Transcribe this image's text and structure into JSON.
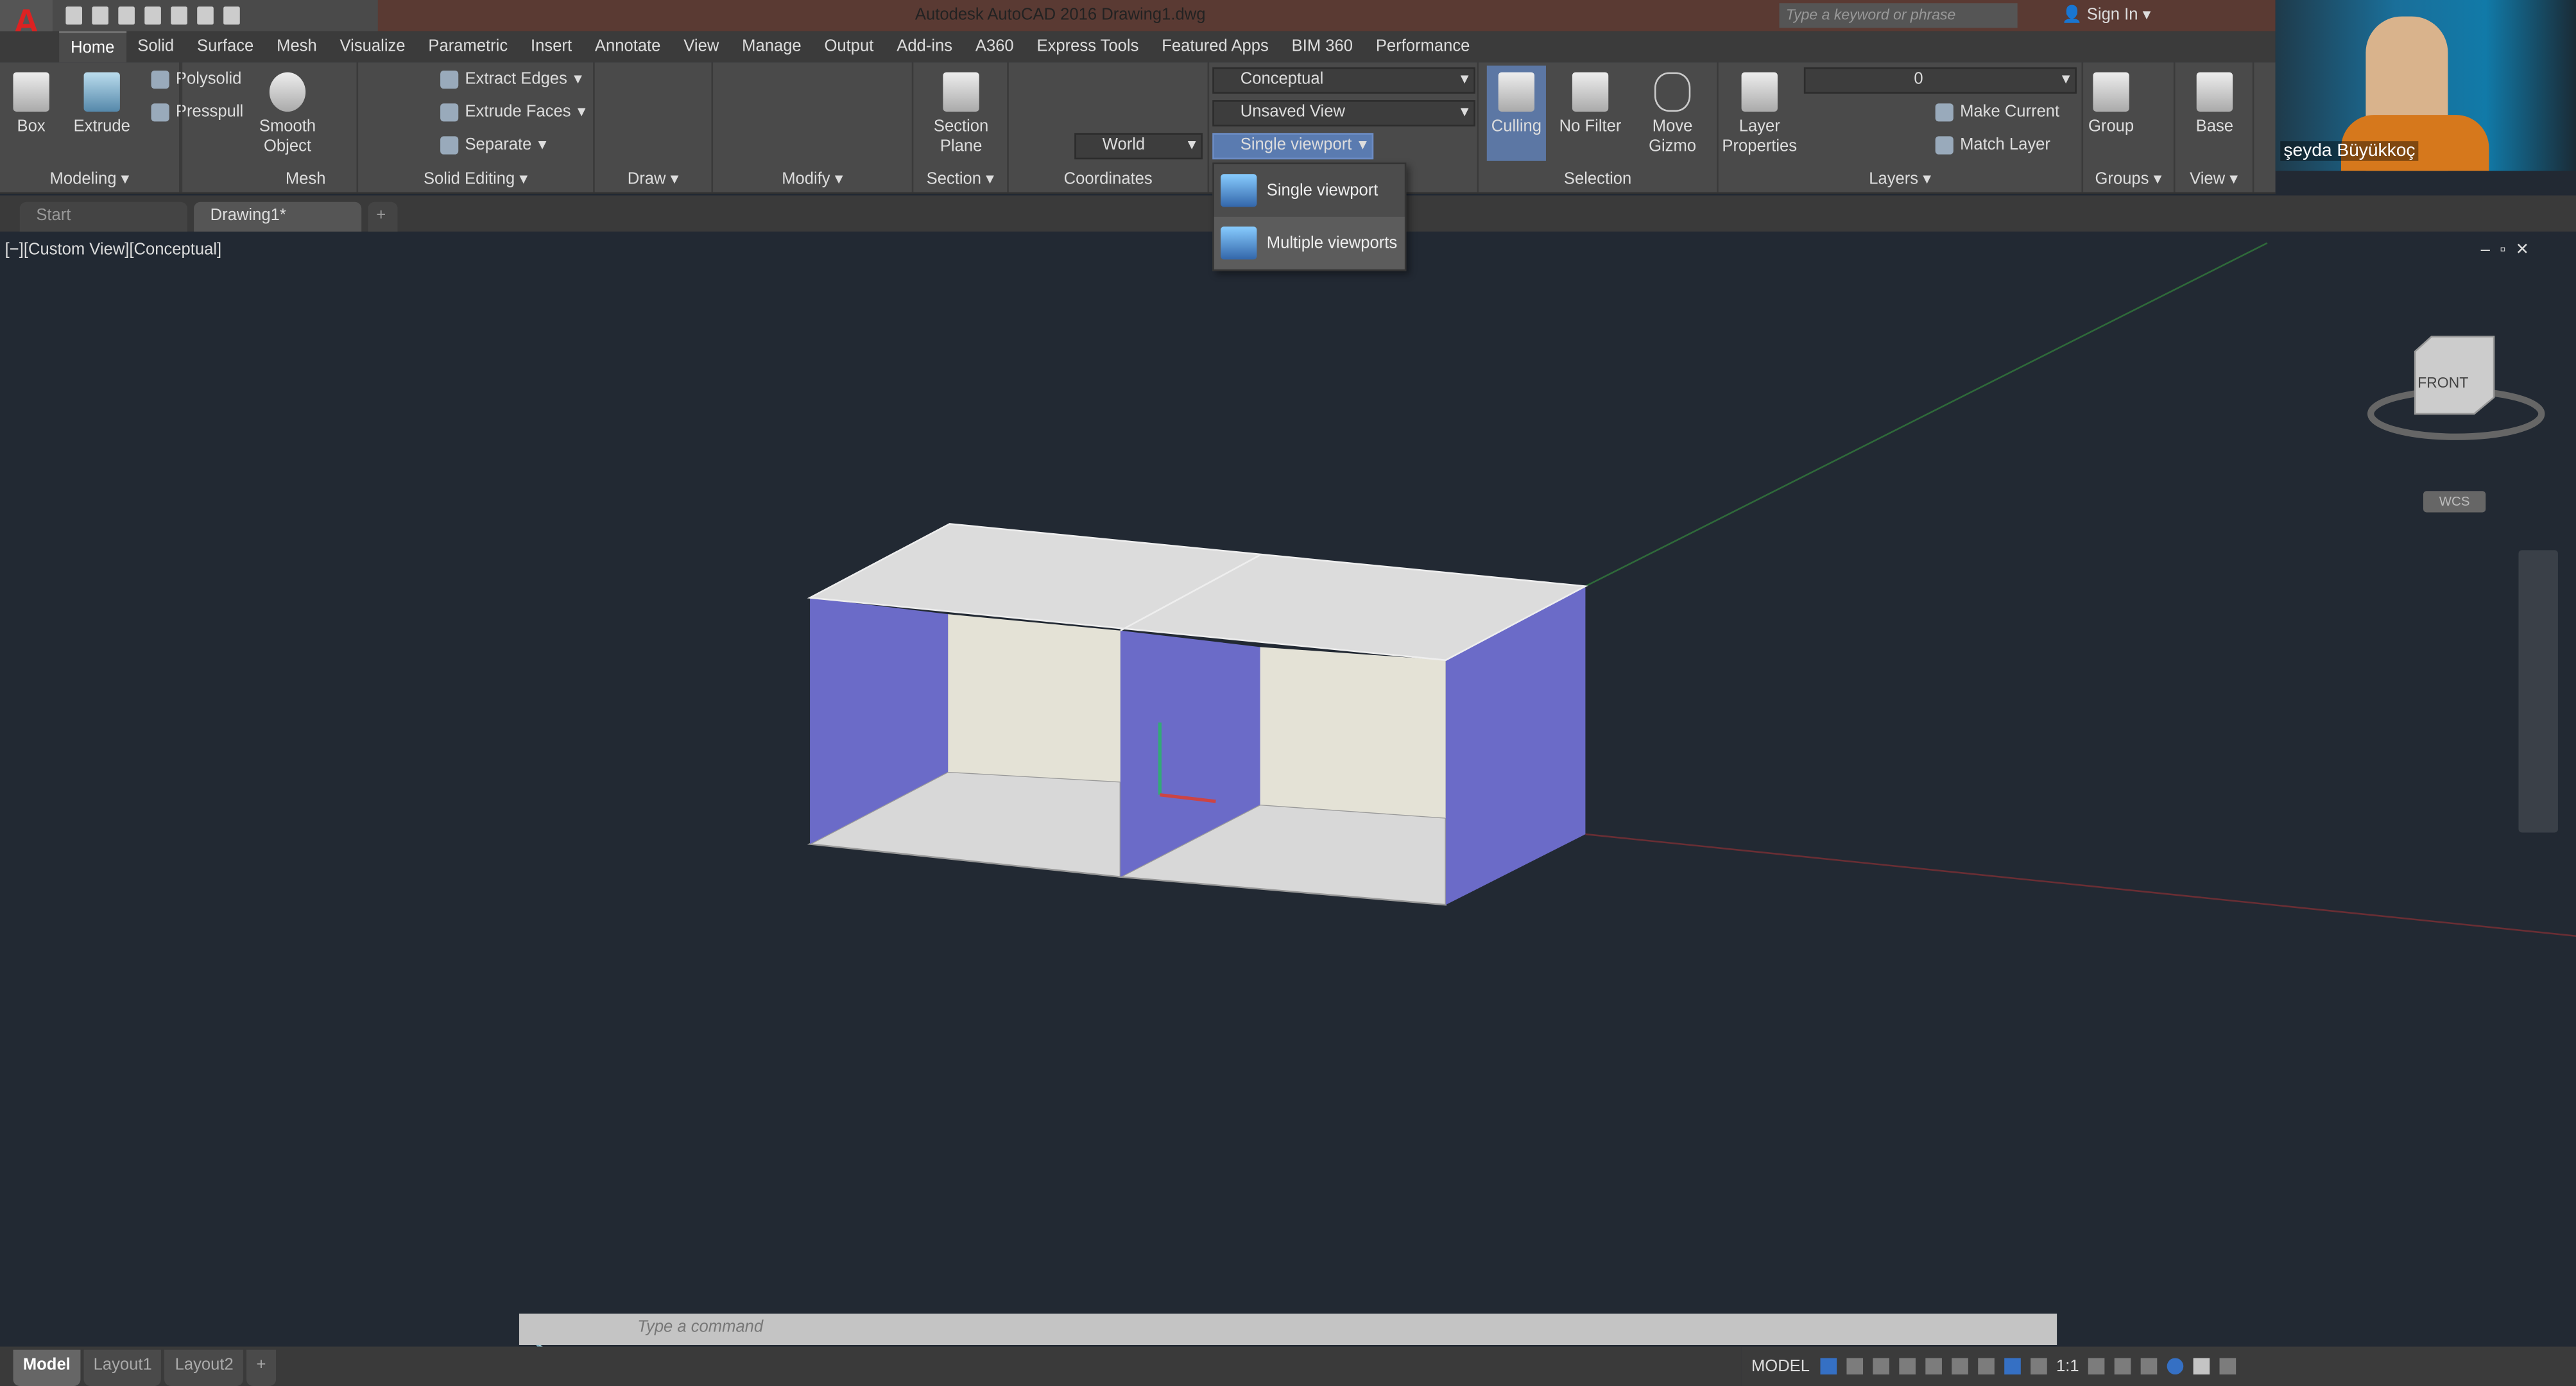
{
  "app": {
    "logo": "A",
    "title": "Autodesk AutoCAD 2016    Drawing1.dwg",
    "search_placeholder": "Type a keyword or phrase",
    "sign_in": "Sign In"
  },
  "ribbon_tabs": [
    "Home",
    "Solid",
    "Surface",
    "Mesh",
    "Visualize",
    "Parametric",
    "Insert",
    "Annotate",
    "View",
    "Manage",
    "Output",
    "Add-ins",
    "A360",
    "Express Tools",
    "Featured Apps",
    "BIM 360",
    "Performance"
  ],
  "panels": {
    "modeling": {
      "label": "Modeling ▾",
      "box": "Box",
      "extrude": "Extrude",
      "polysolid": "Polysolid",
      "presspull": "Presspull"
    },
    "mesh": {
      "label": "Mesh",
      "smooth": "Smooth Object"
    },
    "solid_editing": {
      "label": "Solid Editing ▾",
      "extract_edges": "Extract Edges",
      "extrude_faces": "Extrude Faces",
      "separate": "Separate"
    },
    "draw": {
      "label": "Draw ▾"
    },
    "modify": {
      "label": "Modify ▾"
    },
    "section": {
      "label": "Section ▾",
      "section_plane": "Section Plane"
    },
    "coordinates": {
      "label": "Coordinates",
      "ucs": "World"
    },
    "view": {
      "visual_style": "Conceptual",
      "named_view": "Unsaved View",
      "viewport": "Single viewport"
    },
    "selection": {
      "label": "Selection",
      "culling": "Culling",
      "no_filter": "No Filter",
      "move_gizmo": "Move Gizmo"
    },
    "layers": {
      "label": "Layers ▾",
      "layer_properties": "Layer Properties",
      "current_layer": "0",
      "make_current": "Make Current",
      "match_layer": "Match Layer"
    },
    "groups": {
      "label": "Groups ▾",
      "group": "Group"
    },
    "view_panel": {
      "label": "View ▾",
      "base": "Base"
    }
  },
  "viewport_menu": {
    "items": [
      "Single viewport",
      "Multiple viewports"
    ],
    "hovered": "Multiple viewports"
  },
  "doc_tabs": [
    "Start",
    "Drawing1*"
  ],
  "viewport_label": "[−][Custom View][Conceptual]",
  "viewcube": {
    "face": "FRONT",
    "wcs": "WCS"
  },
  "webcam": {
    "name": "şeyda Büyükkoç"
  },
  "command": {
    "placeholder": "Type a command"
  },
  "layout_tabs": [
    "Model",
    "Layout1",
    "Layout2"
  ],
  "status": {
    "space": "MODEL",
    "scale": "1:1"
  },
  "colors": {
    "purple_wall": "#6b6bc8",
    "beige_wall": "#e4e2d6",
    "top": "#dcdcdc",
    "background": "#222933",
    "title_bar": "#5a3a33"
  }
}
